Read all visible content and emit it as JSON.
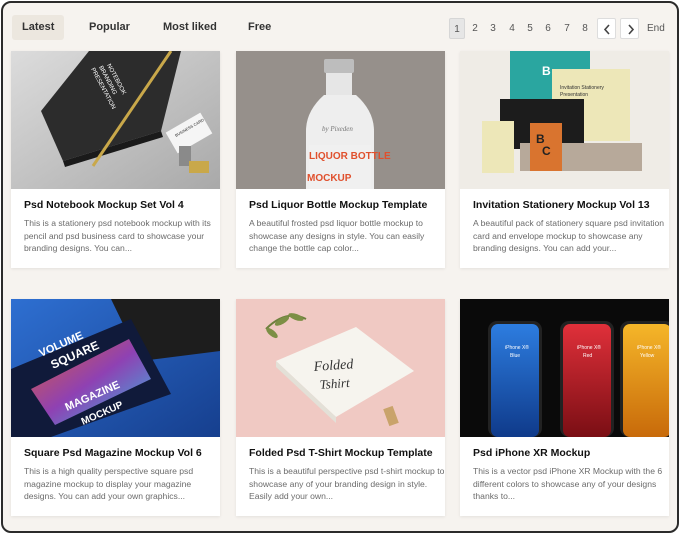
{
  "tabs": [
    {
      "label": "Latest",
      "active": true
    },
    {
      "label": "Popular",
      "active": false
    },
    {
      "label": "Most liked",
      "active": false
    },
    {
      "label": "Free",
      "active": false
    }
  ],
  "pagination": {
    "pages": [
      "1",
      "2",
      "3",
      "4",
      "5",
      "6",
      "7",
      "8"
    ],
    "current": "1",
    "prev_icon": "chevron-left-icon",
    "next_icon": "chevron-right-icon",
    "end_label": "End"
  },
  "cards": [
    {
      "title": "Psd Notebook Mockup Set Vol 4",
      "description": "This is a stationery psd notebook mockup with its pencil and psd business card to showcase your branding designs. You can...",
      "image_text": [
        "NOTEBOOK",
        "BRANDING",
        "PRESENTATION",
        "BUSINESS CARD"
      ]
    },
    {
      "title": "Psd Liquor Bottle Mockup Template",
      "description": "A beautiful frosted psd liquor bottle mockup to showcase any designs in style. You can easily change the bottle cap color...",
      "image_text": [
        "by Pixeden",
        "LIQUOR BOTTLE",
        "MOCKUP"
      ]
    },
    {
      "title": "Invitation Stationery Mockup Vol 13",
      "description": "A beautiful pack of stationery square psd invitation card and envelope mockup to showcase any branding designs. You can add your...",
      "image_text": [
        "B",
        "Invitation Stationery",
        "Presentation",
        "B",
        "C"
      ]
    },
    {
      "title": "Square Psd Magazine Mockup Vol 6",
      "description": "This is a high quality perspective square psd magazine mockup to display your magazine designs. You can add your own graphics...",
      "image_text": [
        "SQUARE",
        "VOLUME",
        "MAGAZINE",
        "MOCKUP"
      ]
    },
    {
      "title": "Folded Psd T-Shirt Mockup Template",
      "description": "This is a beautiful perspective psd t-shirt mockup to showcase any of your branding design in style. Easily add your own...",
      "image_text": [
        "Folded",
        "Tshirt"
      ]
    },
    {
      "title": "Psd iPhone XR Mockup",
      "description": "This is a vector psd iPhone XR Mockup with the 6 different colors to showcase any of your designs thanks to...",
      "image_text": [
        "iPhone X®",
        "Blue",
        "iPhone X®",
        "Red",
        "iPhone X®",
        "Yellow"
      ]
    }
  ],
  "colors": {
    "page_bg": "#f6f3ef",
    "active_tab_bg": "#ece7df",
    "title": "#111111",
    "description": "#6b6b6b"
  }
}
